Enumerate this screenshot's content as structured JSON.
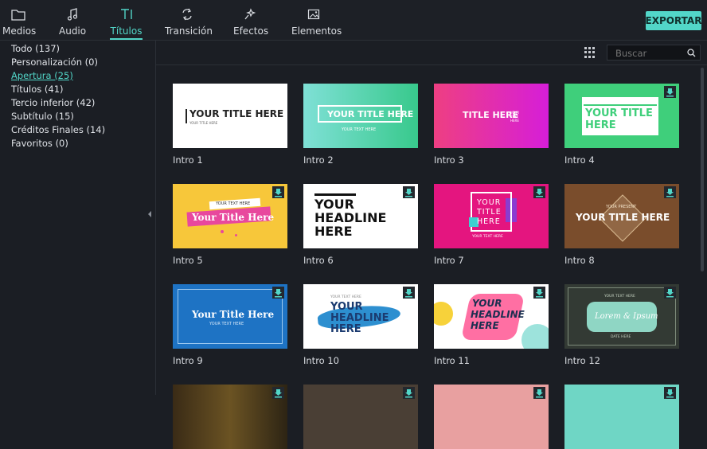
{
  "toolbar": {
    "tabs": [
      {
        "label": "Medios"
      },
      {
        "label": "Audio"
      },
      {
        "label": "Títulos"
      },
      {
        "label": "Transición"
      },
      {
        "label": "Efectos"
      },
      {
        "label": "Elementos"
      }
    ],
    "active_tab": "Títulos",
    "export_label": "EXPORTAR"
  },
  "sidebar": {
    "categories": [
      {
        "label": "Todo (137)"
      },
      {
        "label": "Personalización (0)"
      },
      {
        "label": "Apertura (25)"
      },
      {
        "label": "Títulos (41)"
      },
      {
        "label": "Tercio inferior (42)"
      },
      {
        "label": "Subtítulo (15)"
      },
      {
        "label": "Créditos Finales (14)"
      },
      {
        "label": "Favoritos (0)"
      }
    ],
    "active_category": "Apertura (25)"
  },
  "search": {
    "placeholder": "Buscar"
  },
  "colors": {
    "accent": "#52d6c8",
    "background": "#1b1e24"
  },
  "thumbnails": [
    {
      "caption": "Intro 1",
      "texts": [
        "YOUR TITLE HERE",
        "YOUR TITLE HERE"
      ]
    },
    {
      "caption": "Intro 2",
      "texts": [
        "YOUR TITLE HERE",
        "YOUR TEXT HERE"
      ]
    },
    {
      "caption": "Intro 3",
      "texts": [
        "TITLE HERE",
        "YOUR TEXT HERE"
      ]
    },
    {
      "caption": "Intro 4",
      "texts": [
        "YOUR TITLE",
        "HERE"
      ]
    },
    {
      "caption": "Intro 5",
      "texts": [
        "YOUR TEXT HERE",
        "Your Title Here"
      ]
    },
    {
      "caption": "Intro 6",
      "texts": [
        "YOUR",
        "HEADLINE",
        "HERE"
      ]
    },
    {
      "caption": "Intro 7",
      "texts": [
        "YOUR",
        "TITLE",
        "HERE",
        "YOUR TEXT HERE"
      ]
    },
    {
      "caption": "Intro 8",
      "texts": [
        "YOUR PRESENT",
        "YOUR TITLE HERE"
      ]
    },
    {
      "caption": "Intro 9",
      "texts": [
        "Your Title Here",
        "YOUR TEXT HERE"
      ]
    },
    {
      "caption": "Intro 10",
      "texts": [
        "YOUR TEXT HERE",
        "YOUR",
        "HEADLINE",
        "HERE"
      ]
    },
    {
      "caption": "Intro 11",
      "texts": [
        "YOUR",
        "HEADLINE",
        "HERE"
      ]
    },
    {
      "caption": "Intro 12",
      "texts": [
        "YOUR TEXT HERE",
        "Lorem & Ipsum",
        "DATE HERE"
      ]
    }
  ]
}
